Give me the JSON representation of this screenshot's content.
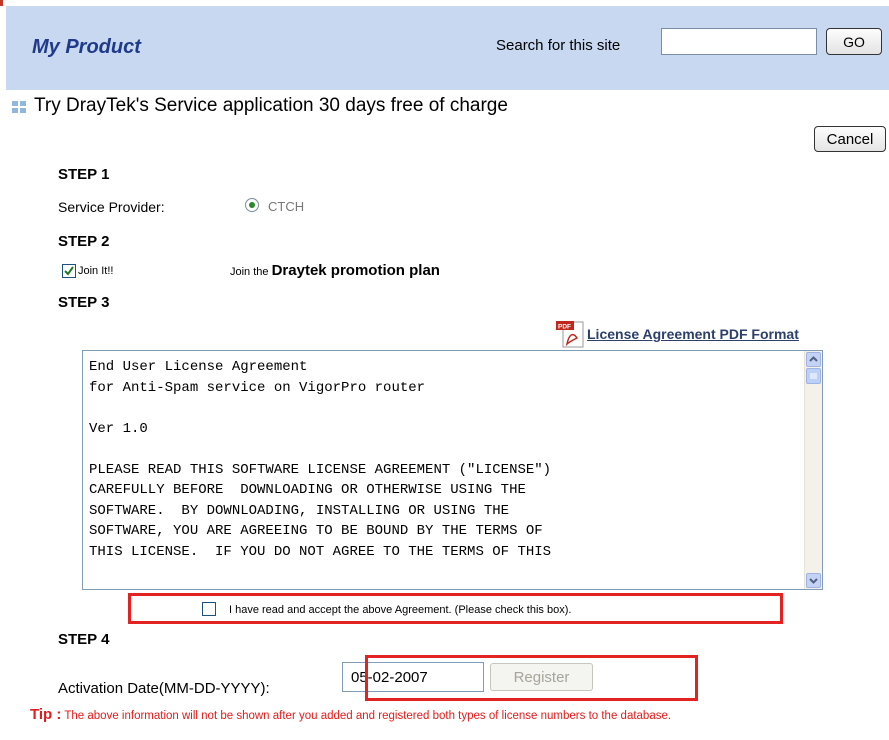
{
  "header": {
    "title": "My Product",
    "search_label": "Search for this site",
    "search_value": "",
    "go_label": "GO"
  },
  "section": {
    "heading": "Try DrayTek's Service application 30 days free of charge",
    "cancel_label": "Cancel"
  },
  "step1": {
    "title": "STEP 1",
    "provider_label": "Service Provider:",
    "provider_option": "CTCH",
    "provider_selected": true
  },
  "step2": {
    "title": "STEP 2",
    "join_label": "Join It!!",
    "join_checked": true,
    "join_desc_prefix": "Join the ",
    "join_desc_bold": "Draytek promotion plan"
  },
  "step3": {
    "title": "STEP 3",
    "pdf_link": "License Agreement PDF Format",
    "license_text": "End User License Agreement\nfor Anti-Spam service on VigorPro router\n\nVer 1.0\n\nPLEASE READ THIS SOFTWARE LICENSE AGREEMENT (\"LICENSE\")\nCAREFULLY BEFORE  DOWNLOADING OR OTHERWISE USING THE\nSOFTWARE.  BY DOWNLOADING, INSTALLING OR USING THE\nSOFTWARE, YOU ARE AGREEING TO BE BOUND BY THE TERMS OF\nTHIS LICENSE.  IF YOU DO NOT AGREE TO THE TERMS OF THIS",
    "agree_label": "I have read and accept the above Agreement. (Please check this box).",
    "agree_checked": false
  },
  "step4": {
    "title": "STEP 4",
    "activation_label": "Activation Date(MM-DD-YYYY):",
    "activation_value": "05-02-2007",
    "register_label": "Register"
  },
  "tip": {
    "label": "Tip :",
    "text": " The above information will not be shown after you added and registered both types of license numbers to the database."
  },
  "colors": {
    "header_bg": "#c8d8f0",
    "title_color": "#1f3a8a",
    "highlight_red": "#e32222",
    "tip_red": "#e31b1b"
  },
  "icons": {
    "heading": "grid-bullet-icon",
    "pdf": "pdf-file-icon",
    "scroll_up": "scroll-up-arrow-icon",
    "scroll_down": "scroll-down-arrow-icon"
  }
}
